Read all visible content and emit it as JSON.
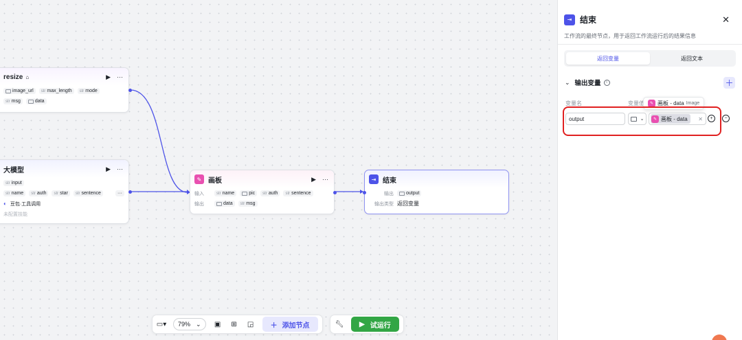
{
  "canvas": {
    "nodes": {
      "resize": {
        "title": "resize",
        "inputs": [
          {
            "type": "image",
            "name": "image_url"
          },
          {
            "type": "str",
            "name": "max_length"
          },
          {
            "type": "str",
            "name": "mode"
          }
        ],
        "outputs": [
          {
            "type": "str",
            "name": "msg"
          },
          {
            "type": "image",
            "name": "data"
          }
        ]
      },
      "llm": {
        "title": "大模型",
        "input_row": [
          {
            "type": "str",
            "name": "input"
          }
        ],
        "params": [
          {
            "type": "str",
            "name": "name"
          },
          {
            "type": "str",
            "name": "auth"
          },
          {
            "type": "str",
            "name": "star"
          },
          {
            "type": "str",
            "name": "sentence"
          }
        ],
        "model": "豆包·工具调用",
        "skills": "未配置技能"
      },
      "board": {
        "title": "画板",
        "input_label": "输入",
        "inputs": [
          {
            "type": "str",
            "name": "name"
          },
          {
            "type": "image",
            "name": "pic"
          },
          {
            "type": "str",
            "name": "auth"
          },
          {
            "type": "str",
            "name": "sentence"
          }
        ],
        "output_label": "输出",
        "outputs": [
          {
            "type": "image",
            "name": "data"
          },
          {
            "type": "str",
            "name": "msg"
          }
        ]
      },
      "end": {
        "title": "结束",
        "output_label": "输出",
        "output_value": "output",
        "output_type_label": "输出类型",
        "output_type_value": "返回变量"
      }
    },
    "more_glyph": "···",
    "run_glyph": "▶"
  },
  "toolbar": {
    "zoom": "79%",
    "add_node_label": "添加节点",
    "run_label": "试运行"
  },
  "panel": {
    "title": "结束",
    "description": "工作流的最终节点，用于返回工作流运行后的结果信息",
    "tabs": [
      {
        "label": "返回变量",
        "active": true
      },
      {
        "label": "返回文本",
        "active": false
      }
    ],
    "section_title": "输出变量",
    "col_var_name": "变量名",
    "col_var_value": "变量值",
    "tooltip_main": "画板 - data",
    "tooltip_sub": "Image",
    "row": {
      "var_name": "output",
      "ref_value": "画板 - data"
    }
  },
  "colors": {
    "accent": "#4d53e8",
    "board_icon": "#e94fb0",
    "run_green": "#32a645",
    "highlight_red": "#e02020"
  }
}
